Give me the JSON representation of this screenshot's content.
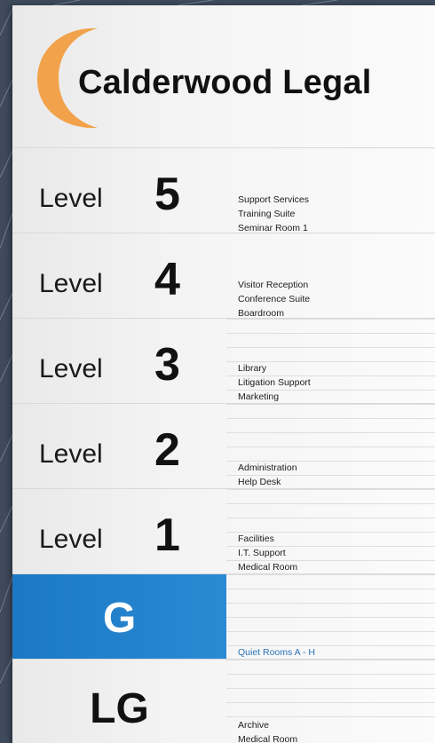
{
  "sign": {
    "brand": "Calderwood Legal",
    "colors": {
      "accent_orange": "#f2a24a",
      "ground_blue": "#1f7fca",
      "text": "#111111"
    },
    "levels": [
      {
        "word": "Level",
        "number": "5",
        "departments": [
          "Support Services",
          "Training Suite",
          "Seminar Room 1"
        ]
      },
      {
        "word": "Level",
        "number": "4",
        "departments": [
          "Visitor Reception",
          "Conference Suite",
          "Boardroom"
        ]
      },
      {
        "word": "Level",
        "number": "3",
        "departments": [
          "Library",
          "Litigation Support",
          "Marketing"
        ]
      },
      {
        "word": "Level",
        "number": "2",
        "departments": [
          "Administration",
          "Help Desk"
        ]
      },
      {
        "word": "Level",
        "number": "1",
        "departments": [
          "Facilities",
          "I.T. Support",
          "Medical Room"
        ]
      },
      {
        "word": "",
        "number": "G",
        "departments": [
          "Quiet Rooms A - H"
        ]
      },
      {
        "word": "",
        "number": "LG",
        "departments": [
          "Archive",
          "Medical Room"
        ]
      }
    ]
  }
}
